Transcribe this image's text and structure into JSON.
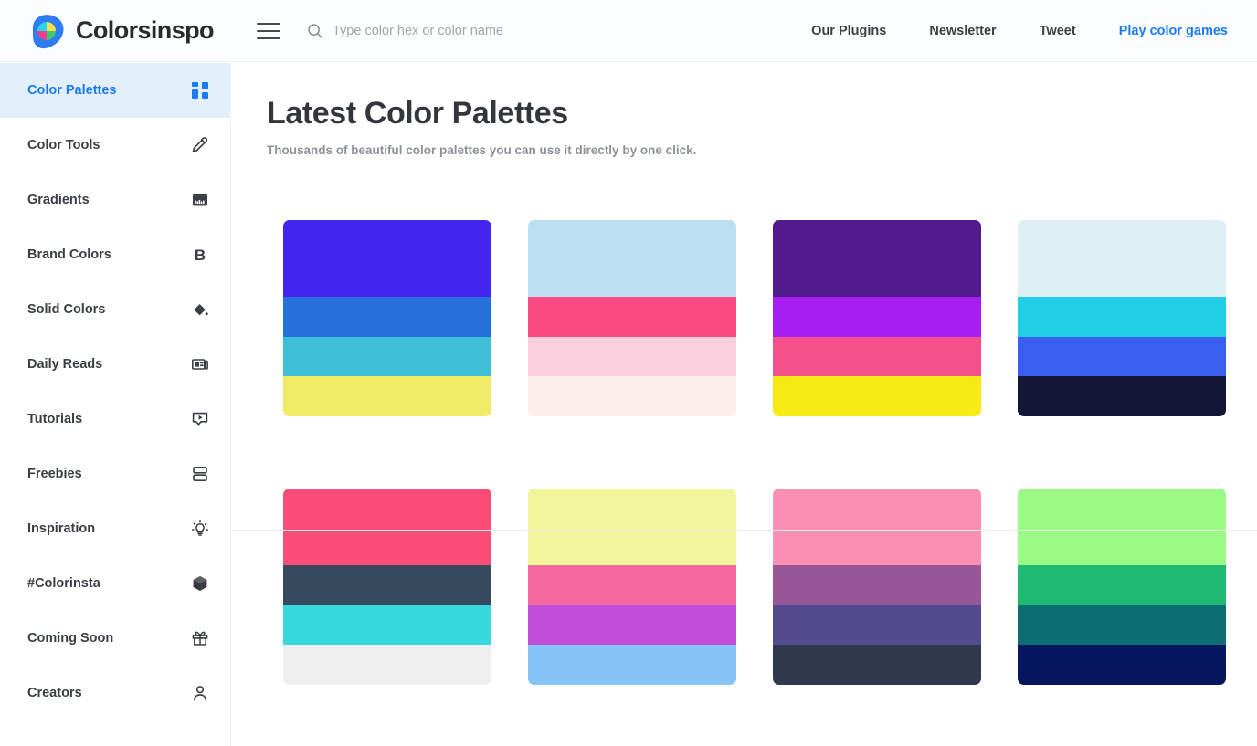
{
  "brand": {
    "name": "Colorsinspo",
    "logo_icon": "color-wheel-logo",
    "logo_colors": [
      "#2e7df5",
      "#28d6e8",
      "#f7e04a",
      "#ef3f8f",
      "#3ac972"
    ]
  },
  "header": {
    "menu_icon": "hamburger-menu-icon",
    "search": {
      "icon": "search-icon",
      "placeholder": "Type color hex or color name",
      "value": ""
    },
    "nav": [
      {
        "label": "Our Plugins",
        "accent": false
      },
      {
        "label": "Newsletter",
        "accent": false
      },
      {
        "label": "Tweet",
        "accent": false
      },
      {
        "label": "Play color games",
        "accent": true
      }
    ],
    "accent_color": "#1a7bf0"
  },
  "sidebar": {
    "items": [
      {
        "label": "Color Palettes",
        "icon": "grid-squares-icon",
        "active": true
      },
      {
        "label": "Color Tools",
        "icon": "eyedropper-icon",
        "active": false
      },
      {
        "label": "Gradients",
        "icon": "gradient-icon",
        "active": false
      },
      {
        "label": "Brand Colors",
        "icon": "letter-b-icon",
        "active": false
      },
      {
        "label": "Solid Colors",
        "icon": "paint-bucket-icon",
        "active": false
      },
      {
        "label": "Daily Reads",
        "icon": "newspaper-icon",
        "active": false
      },
      {
        "label": "Tutorials",
        "icon": "play-video-icon",
        "active": false
      },
      {
        "label": "Freebies",
        "icon": "stacked-bars-icon",
        "active": false
      },
      {
        "label": "Inspiration",
        "icon": "lightbulb-icon",
        "active": false
      },
      {
        "label": "#Colorinsta",
        "icon": "cube-icon",
        "active": false
      },
      {
        "label": "Coming Soon",
        "icon": "gift-icon",
        "active": false
      },
      {
        "label": "Creators",
        "icon": "person-icon",
        "active": false
      }
    ],
    "active_bg": "#e4effc",
    "active_text": "#1a7bf0"
  },
  "main": {
    "title": "Latest Color Palettes",
    "subtitle": "Thousands of beautiful color palettes you can use it directly by one click.",
    "palettes": [
      {
        "name": "palette-1",
        "colors": [
          "#4226ef",
          "#2570db",
          "#40c0d8",
          "#f1ea66"
        ]
      },
      {
        "name": "palette-2",
        "colors": [
          "#bcdff2",
          "#fb4a83",
          "#fbcede",
          "#fdeeeb"
        ]
      },
      {
        "name": "palette-3",
        "colors": [
          "#521b8d",
          "#a71ef0",
          "#f4508b",
          "#f8ea15"
        ]
      },
      {
        "name": "palette-4",
        "colors": [
          "#dff0f4",
          "#22cde6",
          "#3a5ff0",
          "#131637"
        ]
      },
      {
        "name": "palette-5",
        "colors": [
          "#fb4d78",
          "#36495e",
          "#37d9de",
          "#efefef"
        ]
      },
      {
        "name": "palette-6",
        "colors": [
          "#f3f59c",
          "#f4699f",
          "#c24ddb",
          "#86c3f7"
        ]
      },
      {
        "name": "palette-7",
        "colors": [
          "#fb8fb3",
          "#985597",
          "#524c8f",
          "#303a4c"
        ]
      },
      {
        "name": "palette-8",
        "colors": [
          "#9bfa85",
          "#20bb72",
          "#0c6e72",
          "#06165e"
        ]
      }
    ]
  }
}
